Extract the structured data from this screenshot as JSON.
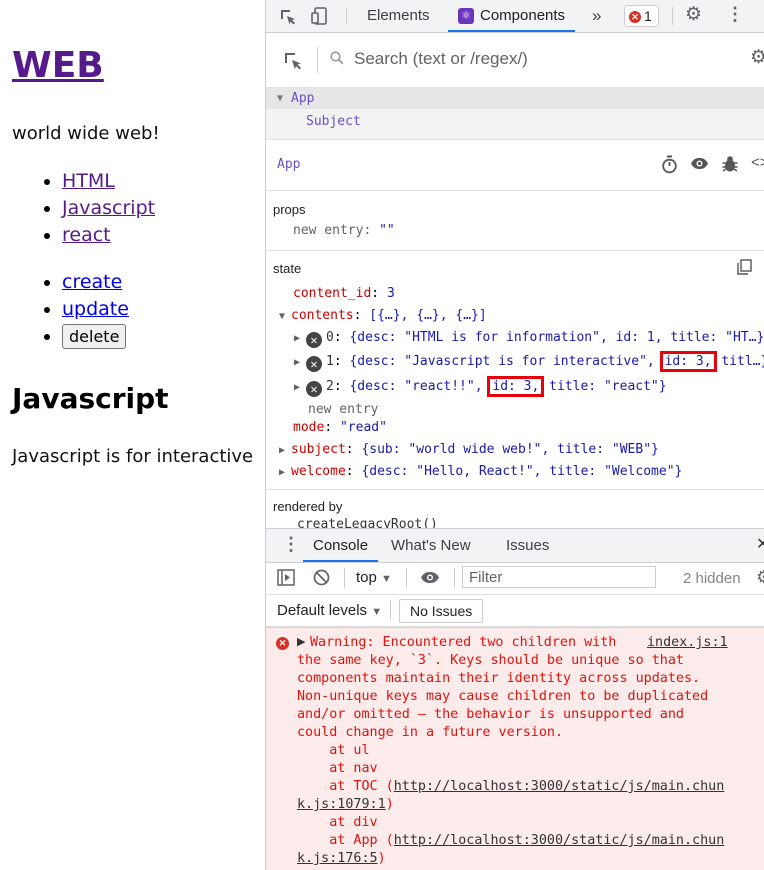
{
  "page": {
    "title": "WEB",
    "subtitle": "world wide web!",
    "toc": [
      "HTML",
      "Javascript",
      "react"
    ],
    "controls": {
      "create": "create",
      "update": "update",
      "delete": "delete"
    },
    "article": {
      "title": "Javascript",
      "desc": "Javascript is for interactive"
    }
  },
  "devtools": {
    "tabs": {
      "elements": "Elements",
      "components": "Components",
      "more": "»"
    },
    "error_count": "1",
    "search_placeholder": "Search (text or /regex/)",
    "tree": {
      "root": "App",
      "child": "Subject"
    },
    "selected": "App",
    "props": {
      "label": "props",
      "new_entry_key": "new entry",
      "new_entry_val": "\"\""
    },
    "state": {
      "label": "state",
      "content_id_key": "content_id",
      "content_id_val": "3",
      "contents_key": "contents",
      "contents_summary": "[{…}, {…}, {…}]",
      "items": [
        {
          "index": "0",
          "pre": "{desc: \"HTML is for information\", id: 1, title: \"HT…}",
          "hl": "",
          "post": ""
        },
        {
          "index": "1",
          "pre": "{desc: \"Javascript is for interactive\",",
          "hl": "id: 3,",
          "post": "titl…}"
        },
        {
          "index": "2",
          "pre": "{desc: \"react!!\",",
          "hl": "id: 3,",
          "post": "title: \"react\"}"
        }
      ],
      "new_entry": "new entry",
      "mode_key": "mode",
      "mode_val": "\"read\"",
      "subject_key": "subject",
      "subject_val": "{sub: \"world wide web!\", title: \"WEB\"}",
      "welcome_key": "welcome",
      "welcome_val": "{desc: \"Hello, React!\", title: \"Welcome\"}"
    },
    "rendered_by": {
      "label": "rendered by",
      "value": "createLegacyRoot()"
    }
  },
  "console": {
    "tabs": {
      "console": "Console",
      "whats_new": "What's New",
      "issues": "Issues"
    },
    "context": "top",
    "filter_placeholder": "Filter",
    "hidden": "2 hidden",
    "levels": "Default levels",
    "no_issues": "No Issues",
    "warning": {
      "source": "index.js:1",
      "line1": "Warning: Encountered two children with",
      "body": "the same key, `3`. Keys should be unique so that\ncomponents maintain their identity across updates.\nNon-unique keys may cause children to be duplicated\nand/or omitted — the behavior is unsupported and\ncould change in a future version.\n    at ul\n    at nav",
      "toc_prefix": "    at TOC (",
      "toc_link_a": "http://localhost:3000/static/js/main.chun",
      "toc_link_b": "k.js:1079:1",
      "div_line": "    at div",
      "app_prefix": "    at App (",
      "app_link_a": "http://localhost:3000/static/js/main.chun",
      "app_link_b": "k.js:176:5"
    }
  }
}
